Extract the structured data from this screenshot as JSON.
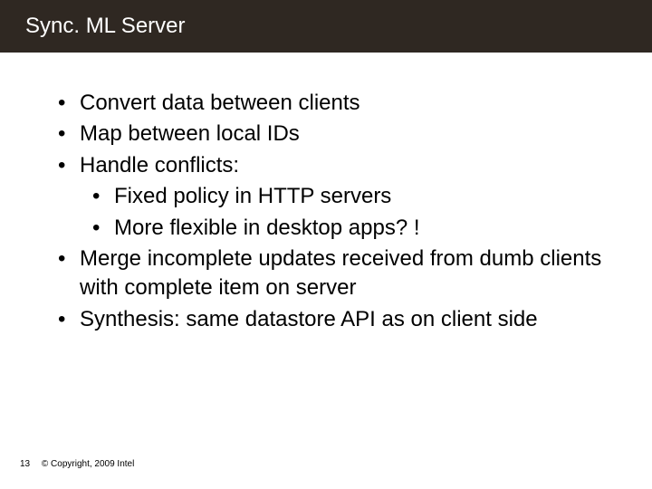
{
  "title": "Sync. ML Server",
  "bullets": {
    "b0": "Convert data between clients",
    "b1": "Map between local IDs",
    "b2": "Handle conflicts:",
    "b2s0": "Fixed policy in HTTP servers",
    "b2s1": "More flexible in desktop apps? !",
    "b3": "Merge incomplete updates received from dumb clients with complete item on server",
    "b4": "Synthesis: same datastore API as on client side"
  },
  "footer": {
    "page": "13",
    "copyright": "© Copyright, 2009 Intel"
  }
}
